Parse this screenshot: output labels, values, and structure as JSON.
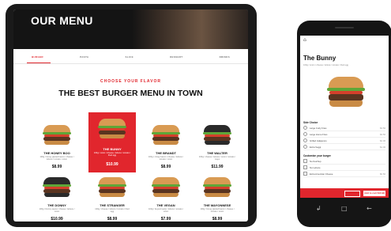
{
  "tablet": {
    "hero_title": "OUR MENU",
    "tabs": [
      "BURGER",
      "PASTA",
      "SLICE",
      "DESSERT",
      "DRINKS"
    ],
    "kicker": "CHOOSE YOUR FLAVOR",
    "headline": "THE BEST BURGER MENU IN TOWN",
    "items": [
      {
        "name": "THE HONEY BOO",
        "desc": "100g / honey glazed bacon / cheese / lettuce / tomato / onion",
        "price": "$8.99"
      },
      {
        "name": "THE BUNNY",
        "desc": "100g / onion / cheese / lettuce / tomato / fried egg",
        "price": "$10.99"
      },
      {
        "name": "THE BRANDT",
        "desc": "100g / crispy bacon / cheese / lettuce / tomato / onion",
        "price": "$8.99"
      },
      {
        "name": "THE WALTER",
        "desc": "100g / cheese / lettuce / onion / tomato / mayo",
        "price": "$11.99"
      },
      {
        "name": "THE DONNY",
        "desc": "100g / Donny sauce / cheese / lettuce / onion",
        "price": "$10.99"
      },
      {
        "name": "THE STRANGER",
        "desc": "100g / cheese / lettuce / tomato / fried egg",
        "price": "$8.99"
      },
      {
        "name": "THE VEGAN",
        "desc": "100g / beyond patty / lettuce / tomato / onion",
        "price": "$7.99"
      },
      {
        "name": "THE MAYONNESE",
        "desc": "100g / honey glazed bacon / cheese / tomato / onion",
        "price": "$8.99"
      }
    ]
  },
  "phone": {
    "back_icon": "back-icon",
    "title": "The Bunny",
    "desc": "100g / onion / cheese / lettuce / tomato / fried egg",
    "section_side": "Side Choice",
    "side_options": [
      {
        "label": "Large Curly Fries",
        "price": "$3.50"
      },
      {
        "label": "Large Home Fries",
        "price": "$3.50"
      },
      {
        "label": "Grilled Jalapenos",
        "price": "$2.00"
      },
      {
        "label": "Extra Veggi",
        "price": "$1.00"
      }
    ],
    "section_custom": "Customize your burger",
    "custom_options": [
      {
        "label": "No Ketchup"
      },
      {
        "label": "No Lettuce"
      },
      {
        "label": "Extra American Cheese",
        "price": "$0.50"
      }
    ],
    "cta_label": "Add to cart  $10.99",
    "nav": {
      "back": "↲",
      "home": "□",
      "recent": "←"
    }
  },
  "colors": {
    "accent": "#e1262d",
    "device": "#1a1a1a"
  }
}
